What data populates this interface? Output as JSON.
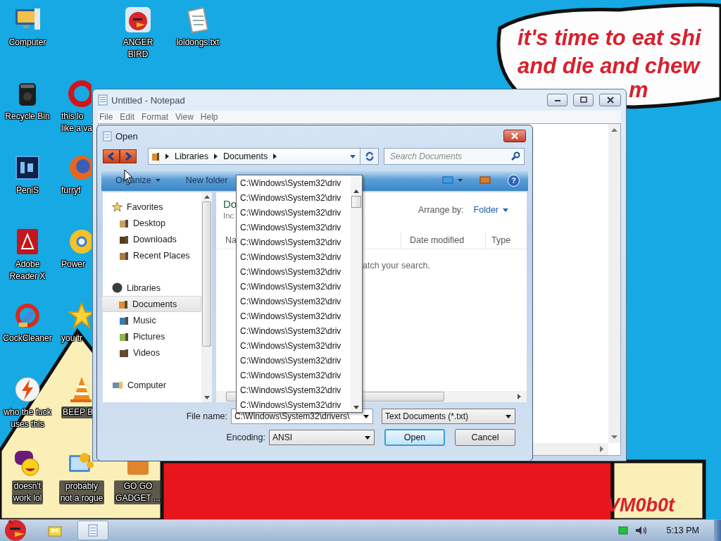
{
  "wallpaper": {
    "bubble_lines": [
      "it's time to eat shi",
      "and die and chew",
      "m"
    ],
    "signature": "VM0b0t"
  },
  "desktop_icons": [
    [
      {
        "lines": [
          "Computer"
        ]
      },
      {
        "lines": [
          "Recycle Bin"
        ]
      },
      {
        "lines": [
          "PeniS"
        ]
      },
      {
        "lines": [
          "Adobe",
          "Reader X"
        ]
      },
      {
        "lines": [
          "CockCleaner"
        ]
      },
      {
        "lines": [
          "who the fuck",
          "uses this"
        ]
      },
      {
        "lines": [
          "doesn't",
          "work lol"
        ]
      }
    ],
    [
      {
        "lines": [
          "this lo",
          "like a va"
        ]
      },
      {
        "lines": [
          "furryf"
        ]
      },
      {
        "lines": [
          "Power"
        ]
      },
      {
        "lines": [
          "you tr"
        ]
      },
      {
        "lines": [
          "BEEP B"
        ]
      },
      {
        "lines": [
          "probably",
          "not a rogue"
        ]
      }
    ],
    [
      {
        "lines": [
          "ANGER",
          "BIRD"
        ]
      },
      {
        "lines": [
          "GO GO",
          "GADGET ..."
        ]
      }
    ],
    [
      {
        "lines": [
          "loldongs.txt"
        ]
      }
    ]
  ],
  "notepad": {
    "title": "Untitled - Notepad",
    "menu": [
      "File",
      "Edit",
      "Format",
      "View",
      "Help"
    ]
  },
  "open_dialog": {
    "title": "Open",
    "breadcrumb": [
      "Libraries",
      "Documents"
    ],
    "search": {
      "placeholder": "Search Documents"
    },
    "toolbar": [
      "Organize",
      "New folder"
    ],
    "help": "?",
    "nav_pane": [
      {
        "label": "Favorites",
        "selected": false,
        "children": [
          {
            "label": "Desktop",
            "selected": false
          },
          {
            "label": "Downloads",
            "selected": false
          },
          {
            "label": "Recent Places",
            "selected": false
          }
        ]
      },
      {
        "label": "Libraries",
        "selected": false,
        "children": [
          {
            "label": "Documents",
            "selected": true
          },
          {
            "label": "Music",
            "selected": false
          },
          {
            "label": "Pictures",
            "selected": false
          },
          {
            "label": "Videos",
            "selected": false
          }
        ]
      },
      {
        "label": "Computer",
        "selected": false
      }
    ],
    "content": {
      "heading": "Do",
      "subheading": "Inc",
      "arrange_label": "Arrange by:",
      "arrange_value": "Folder",
      "columns": [
        "Na",
        "Date modified",
        "Type"
      ],
      "empty_message": "atch your search."
    },
    "file_name": {
      "label": "File name:",
      "value": "C:\\Windows\\System32\\drivers\\"
    },
    "file_type": "Text Documents (*.txt)",
    "encoding": {
      "label": "Encoding:",
      "value": "ANSI"
    },
    "buttons": [
      {
        "label": "Open",
        "default": true
      },
      {
        "label": "Cancel",
        "default": false
      }
    ],
    "suggestions": [
      "C:\\Windows\\System32\\driv",
      "C:\\Windows\\System32\\driv",
      "C:\\Windows\\System32\\driv",
      "C:\\Windows\\System32\\driv",
      "C:\\Windows\\System32\\driv",
      "C:\\Windows\\System32\\driv",
      "C:\\Windows\\System32\\driv",
      "C:\\Windows\\System32\\driv",
      "C:\\Windows\\System32\\driv",
      "C:\\Windows\\System32\\driv",
      "C:\\Windows\\System32\\driv",
      "C:\\Windows\\System32\\driv",
      "C:\\Windows\\System32\\driv",
      "C:\\Windows\\System32\\driv",
      "C:\\Windows\\System32\\driv",
      "C:\\Windows\\System32\\driv"
    ]
  },
  "taskbar": {
    "clock": "5:13 PM"
  }
}
